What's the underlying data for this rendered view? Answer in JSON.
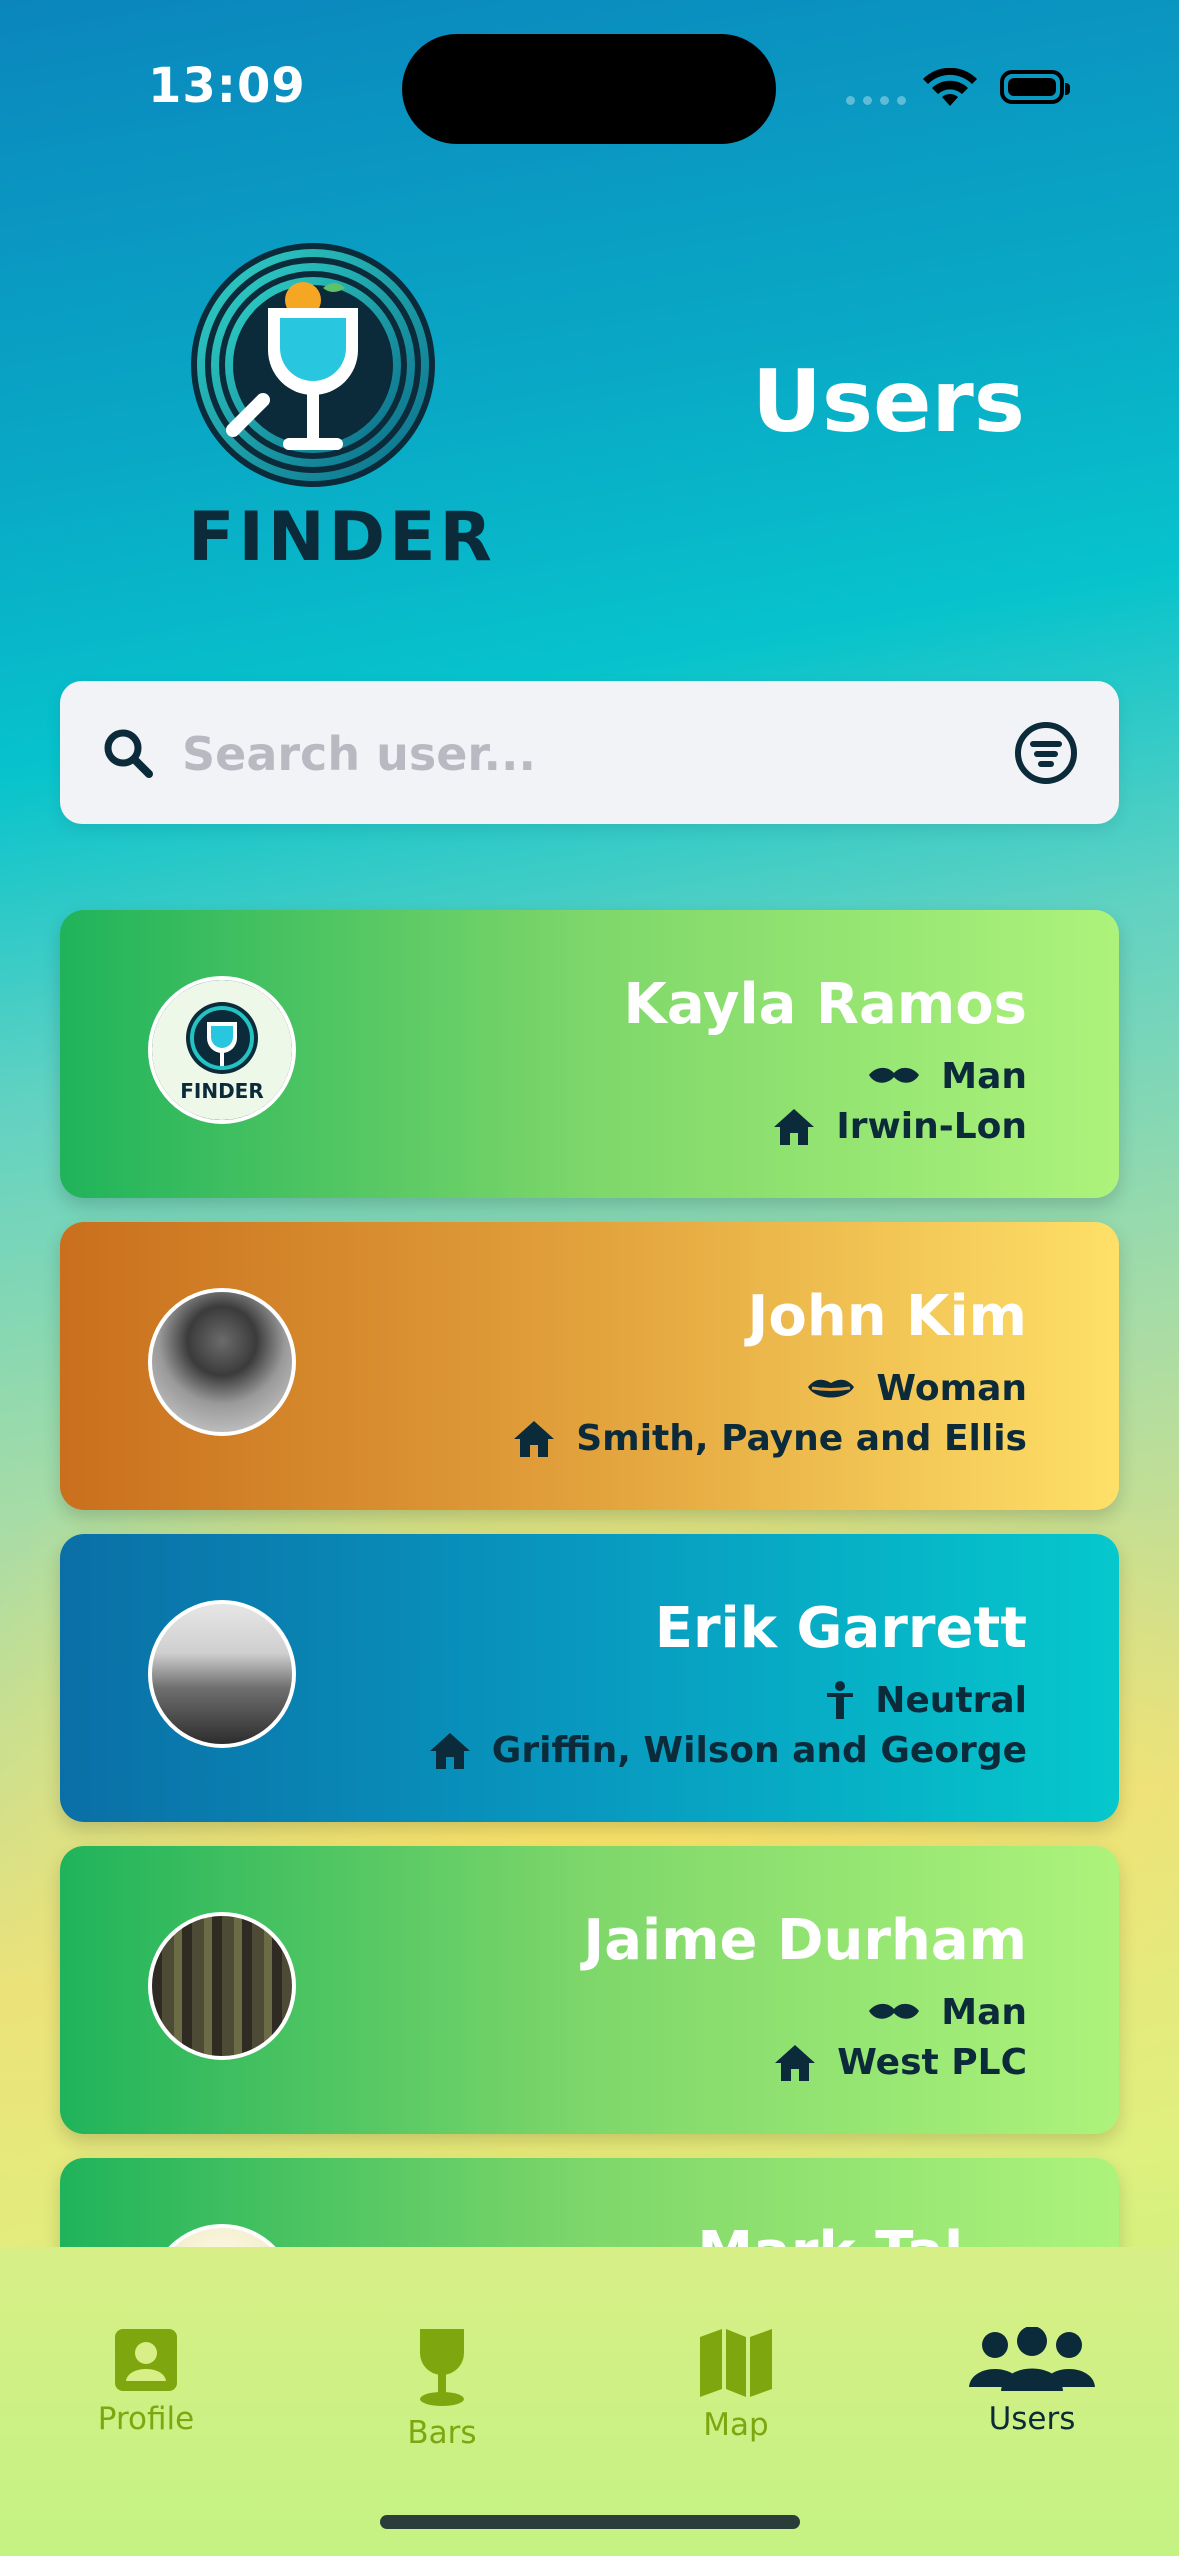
{
  "status_bar": {
    "time": "13:09"
  },
  "header": {
    "logo_text": "FINDER",
    "title": "Users"
  },
  "search": {
    "placeholder": "Search user..."
  },
  "users": [
    {
      "name": "Kayla Ramos",
      "gender": "Man",
      "gender_icon": "mustache-icon",
      "place": "Irwin-Lon",
      "avatar": "finder-logo",
      "theme": "green"
    },
    {
      "name": "John Kim",
      "gender": "Woman",
      "gender_icon": "lips-icon",
      "place": "Smith, Payne and Ellis",
      "avatar": "photo",
      "theme": "orange"
    },
    {
      "name": "Erik Garrett",
      "gender": "Neutral",
      "gender_icon": "person-icon",
      "place": "Griffin, Wilson and George",
      "avatar": "photo",
      "theme": "blue"
    },
    {
      "name": "Jaime Durham",
      "gender": "Man",
      "gender_icon": "mustache-icon",
      "place": "West PLC",
      "avatar": "photo",
      "theme": "green"
    },
    {
      "name": "Mark Tal...",
      "theme": "green",
      "avatar": "photo",
      "partially_visible": true
    }
  ],
  "tabs": [
    {
      "label": "Profile",
      "icon": "profile-card-icon",
      "active": false
    },
    {
      "label": "Bars",
      "icon": "wine-glass-icon",
      "active": false
    },
    {
      "label": "Map",
      "icon": "map-icon",
      "active": false
    },
    {
      "label": "Users",
      "icon": "users-icon",
      "active": true
    }
  ],
  "colors": {
    "accent_dark": "#0b2a3a",
    "tab_inactive": "#7ea70f",
    "card_green": "#7ed76a",
    "card_orange": "#e2a23c",
    "card_blue": "#0899c0"
  }
}
